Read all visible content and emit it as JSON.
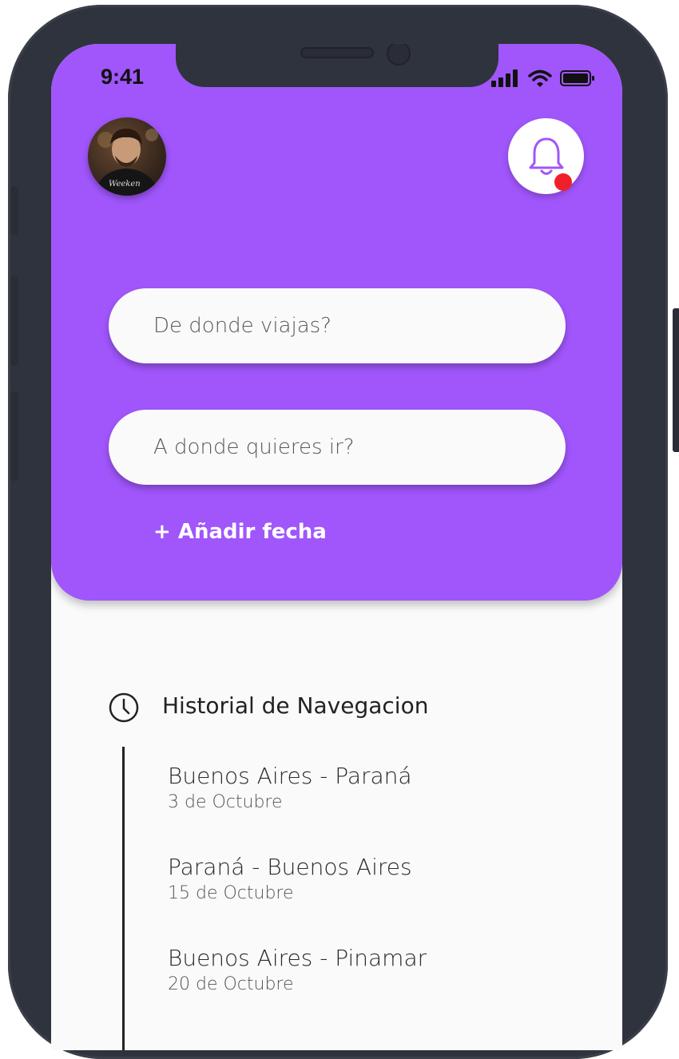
{
  "status_bar": {
    "time": "9:41",
    "icons": [
      "signal-icon",
      "wifi-icon",
      "battery-icon"
    ]
  },
  "header": {
    "background_color": "#a056fb",
    "avatar": "user-avatar",
    "notification_icon": "bell-icon",
    "notification_badge_color": "#f0202a"
  },
  "search": {
    "origin_placeholder": "De donde viajas?",
    "destination_placeholder": "A donde quieres ir?",
    "add_date_label": "+ Añadir fecha"
  },
  "history": {
    "icon": "clock-icon",
    "title": "Historial de Navegacion",
    "items": [
      {
        "route": "Buenos Aires - Paraná",
        "date": "3 de Octubre"
      },
      {
        "route": "Paraná - Buenos Aires",
        "date": "15 de Octubre"
      },
      {
        "route": "Buenos Aires - Pinamar",
        "date": "20 de Octubre"
      }
    ]
  }
}
